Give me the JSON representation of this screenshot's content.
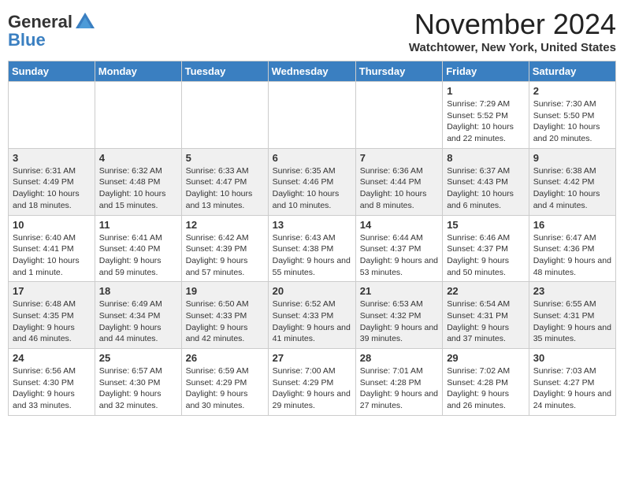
{
  "header": {
    "logo_general": "General",
    "logo_blue": "Blue",
    "month_title": "November 2024",
    "location": "Watchtower, New York, United States"
  },
  "weekdays": [
    "Sunday",
    "Monday",
    "Tuesday",
    "Wednesday",
    "Thursday",
    "Friday",
    "Saturday"
  ],
  "weeks": [
    [
      {
        "day": "",
        "info": ""
      },
      {
        "day": "",
        "info": ""
      },
      {
        "day": "",
        "info": ""
      },
      {
        "day": "",
        "info": ""
      },
      {
        "day": "",
        "info": ""
      },
      {
        "day": "1",
        "info": "Sunrise: 7:29 AM\nSunset: 5:52 PM\nDaylight: 10 hours and 22 minutes."
      },
      {
        "day": "2",
        "info": "Sunrise: 7:30 AM\nSunset: 5:50 PM\nDaylight: 10 hours and 20 minutes."
      }
    ],
    [
      {
        "day": "3",
        "info": "Sunrise: 6:31 AM\nSunset: 4:49 PM\nDaylight: 10 hours and 18 minutes."
      },
      {
        "day": "4",
        "info": "Sunrise: 6:32 AM\nSunset: 4:48 PM\nDaylight: 10 hours and 15 minutes."
      },
      {
        "day": "5",
        "info": "Sunrise: 6:33 AM\nSunset: 4:47 PM\nDaylight: 10 hours and 13 minutes."
      },
      {
        "day": "6",
        "info": "Sunrise: 6:35 AM\nSunset: 4:46 PM\nDaylight: 10 hours and 10 minutes."
      },
      {
        "day": "7",
        "info": "Sunrise: 6:36 AM\nSunset: 4:44 PM\nDaylight: 10 hours and 8 minutes."
      },
      {
        "day": "8",
        "info": "Sunrise: 6:37 AM\nSunset: 4:43 PM\nDaylight: 10 hours and 6 minutes."
      },
      {
        "day": "9",
        "info": "Sunrise: 6:38 AM\nSunset: 4:42 PM\nDaylight: 10 hours and 4 minutes."
      }
    ],
    [
      {
        "day": "10",
        "info": "Sunrise: 6:40 AM\nSunset: 4:41 PM\nDaylight: 10 hours and 1 minute."
      },
      {
        "day": "11",
        "info": "Sunrise: 6:41 AM\nSunset: 4:40 PM\nDaylight: 9 hours and 59 minutes."
      },
      {
        "day": "12",
        "info": "Sunrise: 6:42 AM\nSunset: 4:39 PM\nDaylight: 9 hours and 57 minutes."
      },
      {
        "day": "13",
        "info": "Sunrise: 6:43 AM\nSunset: 4:38 PM\nDaylight: 9 hours and 55 minutes."
      },
      {
        "day": "14",
        "info": "Sunrise: 6:44 AM\nSunset: 4:37 PM\nDaylight: 9 hours and 53 minutes."
      },
      {
        "day": "15",
        "info": "Sunrise: 6:46 AM\nSunset: 4:37 PM\nDaylight: 9 hours and 50 minutes."
      },
      {
        "day": "16",
        "info": "Sunrise: 6:47 AM\nSunset: 4:36 PM\nDaylight: 9 hours and 48 minutes."
      }
    ],
    [
      {
        "day": "17",
        "info": "Sunrise: 6:48 AM\nSunset: 4:35 PM\nDaylight: 9 hours and 46 minutes."
      },
      {
        "day": "18",
        "info": "Sunrise: 6:49 AM\nSunset: 4:34 PM\nDaylight: 9 hours and 44 minutes."
      },
      {
        "day": "19",
        "info": "Sunrise: 6:50 AM\nSunset: 4:33 PM\nDaylight: 9 hours and 42 minutes."
      },
      {
        "day": "20",
        "info": "Sunrise: 6:52 AM\nSunset: 4:33 PM\nDaylight: 9 hours and 41 minutes."
      },
      {
        "day": "21",
        "info": "Sunrise: 6:53 AM\nSunset: 4:32 PM\nDaylight: 9 hours and 39 minutes."
      },
      {
        "day": "22",
        "info": "Sunrise: 6:54 AM\nSunset: 4:31 PM\nDaylight: 9 hours and 37 minutes."
      },
      {
        "day": "23",
        "info": "Sunrise: 6:55 AM\nSunset: 4:31 PM\nDaylight: 9 hours and 35 minutes."
      }
    ],
    [
      {
        "day": "24",
        "info": "Sunrise: 6:56 AM\nSunset: 4:30 PM\nDaylight: 9 hours and 33 minutes."
      },
      {
        "day": "25",
        "info": "Sunrise: 6:57 AM\nSunset: 4:30 PM\nDaylight: 9 hours and 32 minutes."
      },
      {
        "day": "26",
        "info": "Sunrise: 6:59 AM\nSunset: 4:29 PM\nDaylight: 9 hours and 30 minutes."
      },
      {
        "day": "27",
        "info": "Sunrise: 7:00 AM\nSunset: 4:29 PM\nDaylight: 9 hours and 29 minutes."
      },
      {
        "day": "28",
        "info": "Sunrise: 7:01 AM\nSunset: 4:28 PM\nDaylight: 9 hours and 27 minutes."
      },
      {
        "day": "29",
        "info": "Sunrise: 7:02 AM\nSunset: 4:28 PM\nDaylight: 9 hours and 26 minutes."
      },
      {
        "day": "30",
        "info": "Sunrise: 7:03 AM\nSunset: 4:27 PM\nDaylight: 9 hours and 24 minutes."
      }
    ]
  ]
}
